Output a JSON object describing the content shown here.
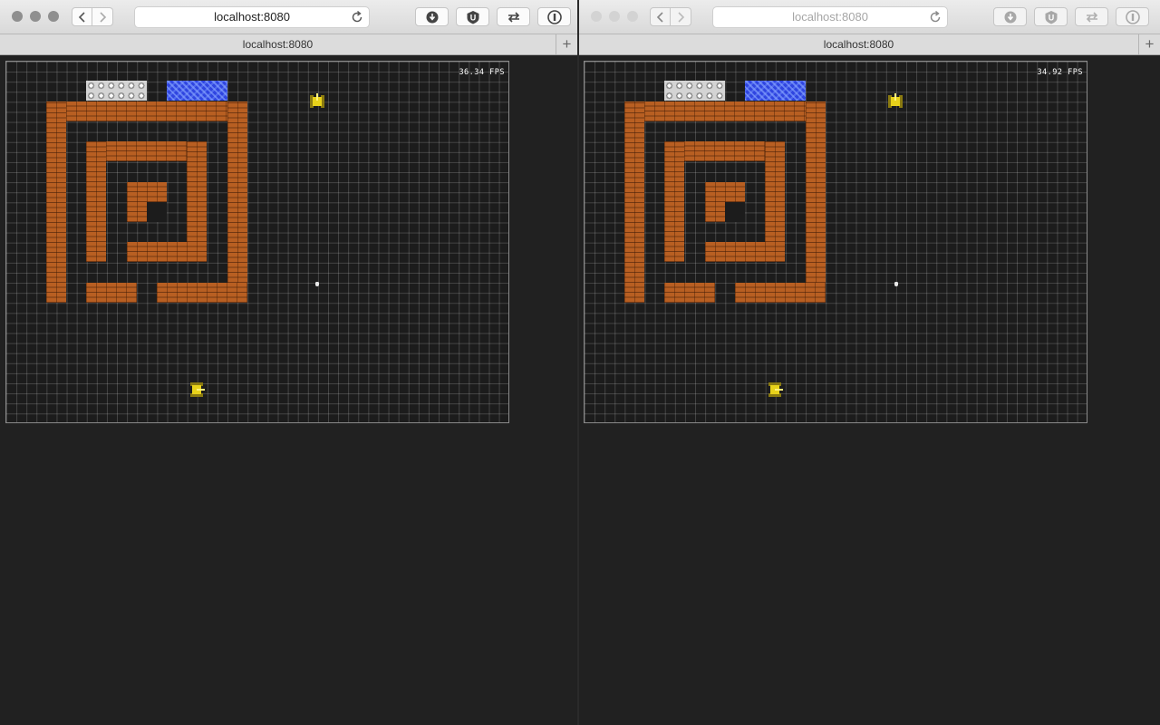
{
  "windows": [
    {
      "url": "localhost:8080",
      "tab_title": "localhost:8080",
      "new_tab_label": "+",
      "fps": "36.34 FPS",
      "toolbar_icons": [
        "back-icon",
        "forward-icon",
        "reload-icon",
        "download-icon",
        "ublock-icon",
        "transfer-icon",
        "onepassword-icon"
      ]
    },
    {
      "url": "localhost:8080",
      "tab_title": "localhost:8080",
      "new_tab_label": "+",
      "fps": "34.92 FPS",
      "toolbar_icons": [
        "back-icon",
        "forward-icon",
        "reload-icon",
        "download-icon",
        "ublock-icon",
        "transfer-icon",
        "onepassword-icon"
      ]
    }
  ],
  "colors": {
    "brick": "#b85f22",
    "steel": "#cfcfcf",
    "water": "#2f45e0",
    "tank": "#e8d21a",
    "background": "#212121"
  }
}
